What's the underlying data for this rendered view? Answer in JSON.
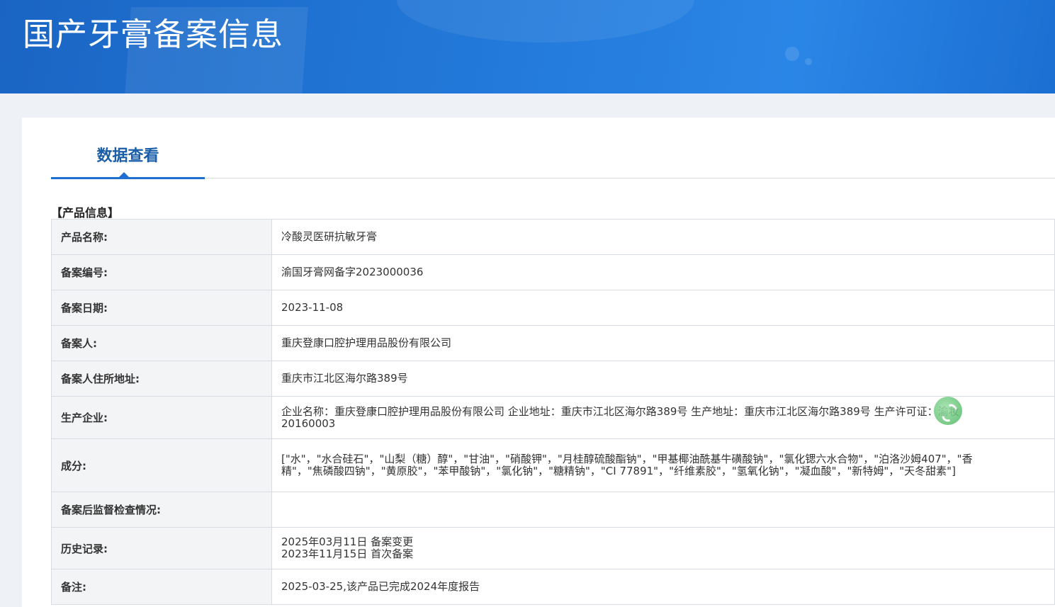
{
  "header": {
    "title": "国产牙膏备案信息"
  },
  "tab": {
    "label": "数据查看"
  },
  "section": {
    "title": "【产品信息】"
  },
  "rows": [
    {
      "label": "产品名称:",
      "value": "冷酸灵医研抗敏牙膏"
    },
    {
      "label": "备案编号:",
      "value": "渝国牙膏网备字2023000036"
    },
    {
      "label": "备案日期:",
      "value": "2023-11-08"
    },
    {
      "label": "备案人:",
      "value": "重庆登康口腔护理用品股份有限公司"
    },
    {
      "label": "备案人住所地址:",
      "value": "重庆市江北区海尔路389号"
    },
    {
      "label": "生产企业:",
      "value": "企业名称：重庆登康口腔护理用品股份有限公司 企业地址：重庆市江北区海尔路389号 生产地址：重庆市江北区海尔路389号 生产许可证：渝妆20160003"
    },
    {
      "label": "成分:",
      "value": "[\"水\"，\"水合硅石\"，\"山梨（糖）醇\"，\"甘油\"，\"硝酸钾\"，\"月桂醇硫酸酯钠\"，\"甲基椰油酰基牛磺酸钠\"，\"氯化锶六水合物\"，\"泊洛沙姆407\"，\"香精\"，\"焦磷酸四钠\"，\"黄原胶\"，\"苯甲酸钠\"，\"氯化钠\"，\"糖精钠\"，\"CI 77891\"，\"纤维素胶\"，\"氢氧化钠\"，\"凝血酸\"，\"新特姆\"，\"天冬甜素\"]"
    },
    {
      "label": "备案后监督检查情况:",
      "value": ""
    },
    {
      "label": "历史记录:",
      "value": "",
      "lines": [
        "2025年03月11日 备案变更",
        "2023年11月15日 首次备案"
      ]
    },
    {
      "label": "备注:",
      "value": "2025-03-25,该产品已完成2024年度报告"
    }
  ]
}
